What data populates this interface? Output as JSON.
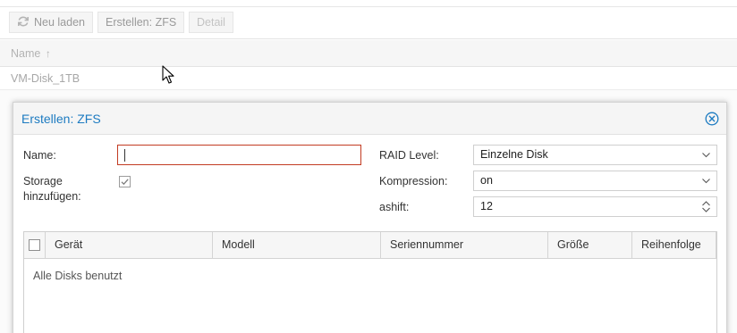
{
  "toolbar": {
    "reload_label": "Neu laden",
    "create_zfs_label": "Erstellen: ZFS",
    "detail_label": "Detail"
  },
  "grid": {
    "columns": [
      {
        "label": "Name",
        "sort_icon": "↑"
      }
    ],
    "rows": [
      {
        "name": "VM-Disk_1TB"
      }
    ]
  },
  "dialog": {
    "title": "Erstellen: ZFS",
    "close_icon": "close-circle-icon",
    "name_label": "Name:",
    "name_value": "",
    "storage_label_line1": "Storage",
    "storage_label_line2": "hinzufügen:",
    "storage_checked": true,
    "raid_label": "RAID Level:",
    "raid_value": "Einzelne Disk",
    "compression_label": "Kompression:",
    "compression_value": "on",
    "ashift_label": "ashift:",
    "ashift_value": "12",
    "disk_table": {
      "columns": [
        "Gerät",
        "Modell",
        "Seriennummer",
        "Größe",
        "Reihenfolge"
      ],
      "empty_text": "Alle Disks benutzt"
    }
  },
  "colors": {
    "accent": "#1d7bc1",
    "invalid_border": "#c23b22",
    "disabled_text": "#a7a7a7"
  }
}
